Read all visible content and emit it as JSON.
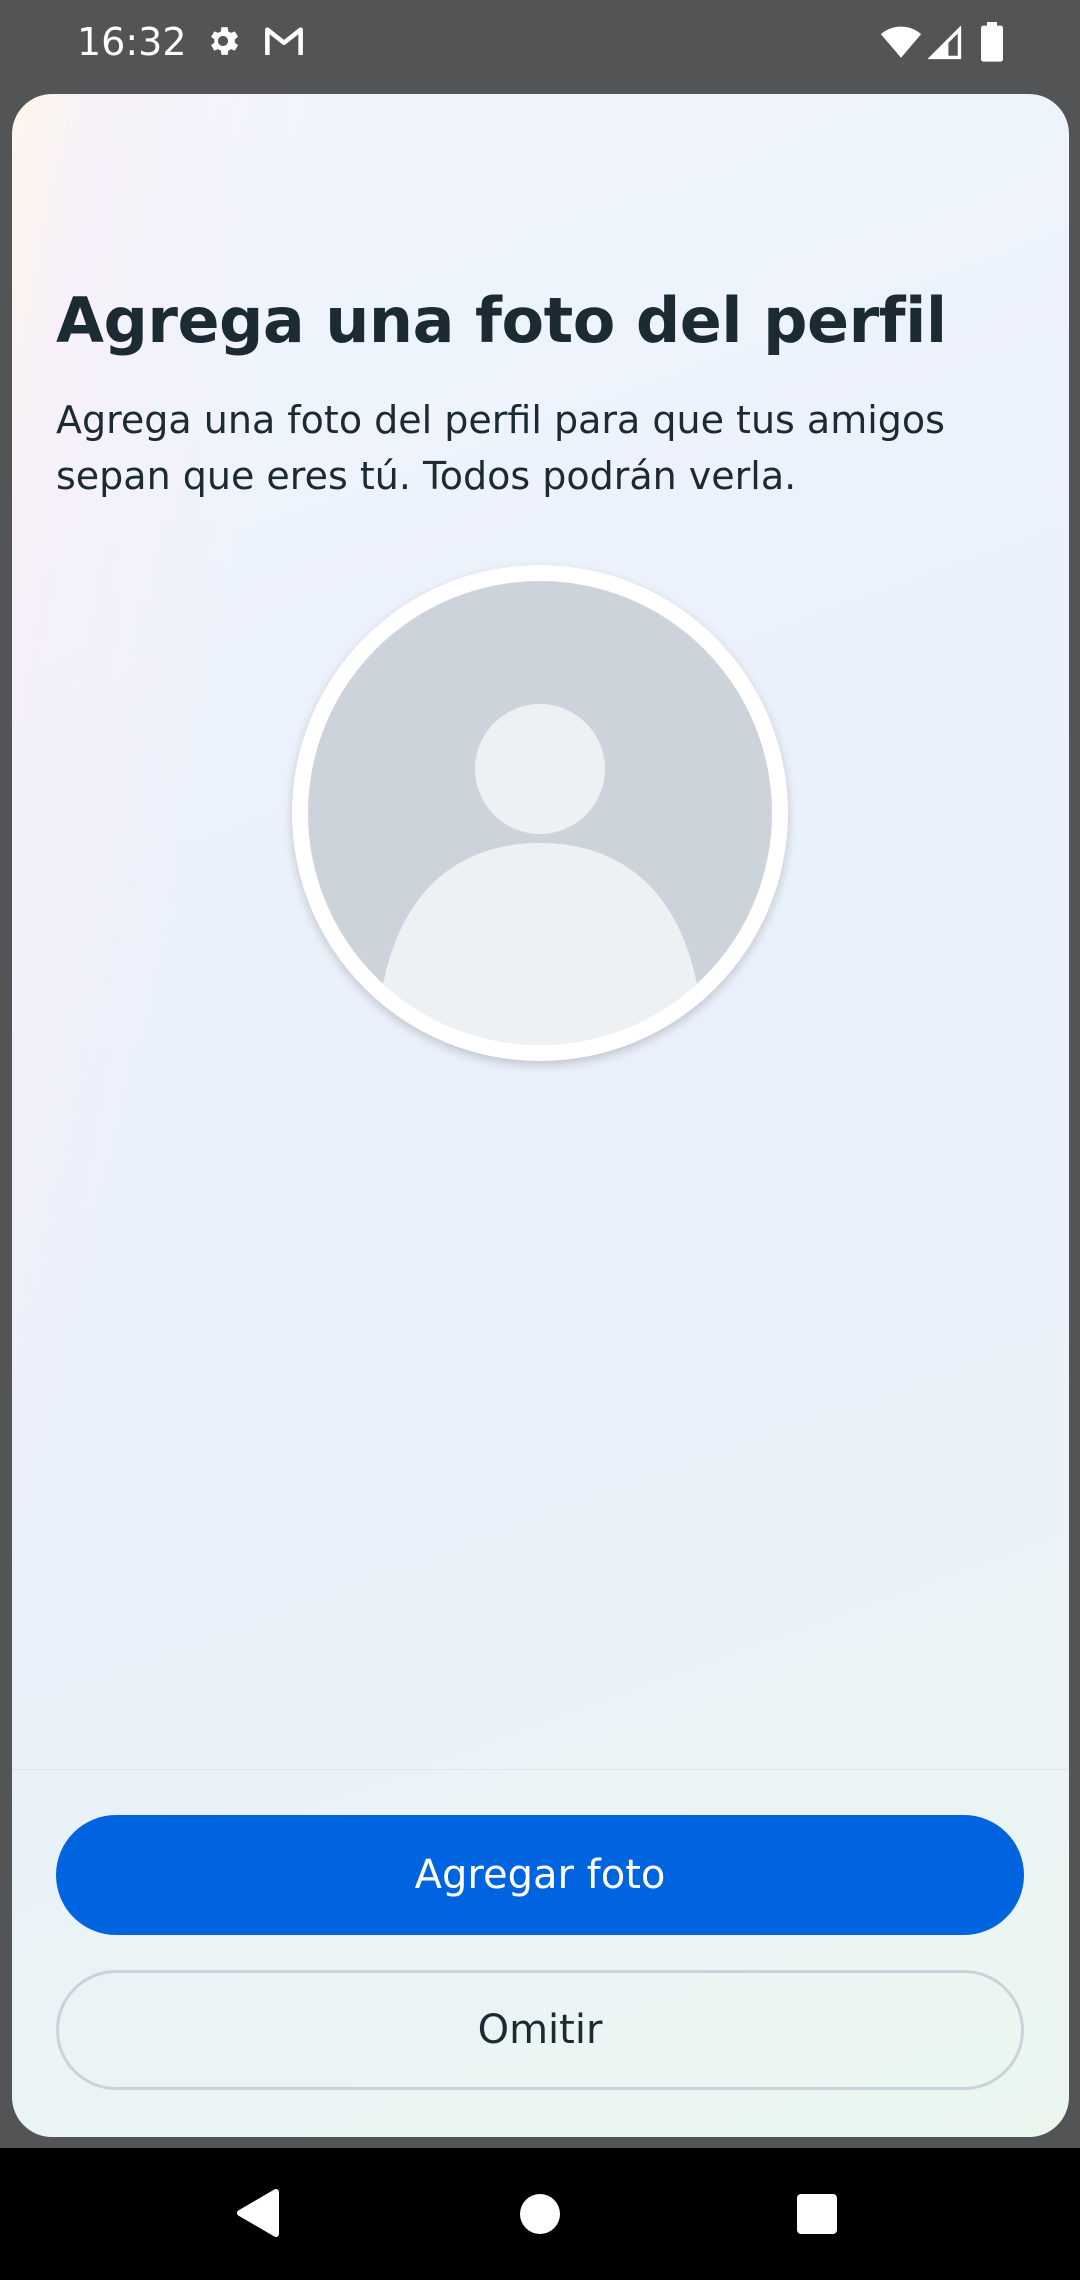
{
  "status_bar": {
    "time": "16:32",
    "icons": [
      "settings-icon",
      "gmail-icon",
      "wifi-icon",
      "signal-icon",
      "battery-icon"
    ]
  },
  "main": {
    "title": "Agrega una foto del perfil",
    "subtitle": "Agrega una foto del perfil para que tus amigos sepan que eres tú. Todos podrán verla.",
    "avatar_icon": "default-profile-icon"
  },
  "actions": {
    "add_photo_label": "Agregar foto",
    "skip_label": "Omitir"
  },
  "nav_bar": {
    "icons": [
      "back-icon",
      "home-icon",
      "recents-icon"
    ]
  },
  "colors": {
    "primary": "#0064e0",
    "text": "#1c2b33",
    "avatar_bg": "#cdd3da",
    "avatar_fg": "#eef1f4"
  }
}
